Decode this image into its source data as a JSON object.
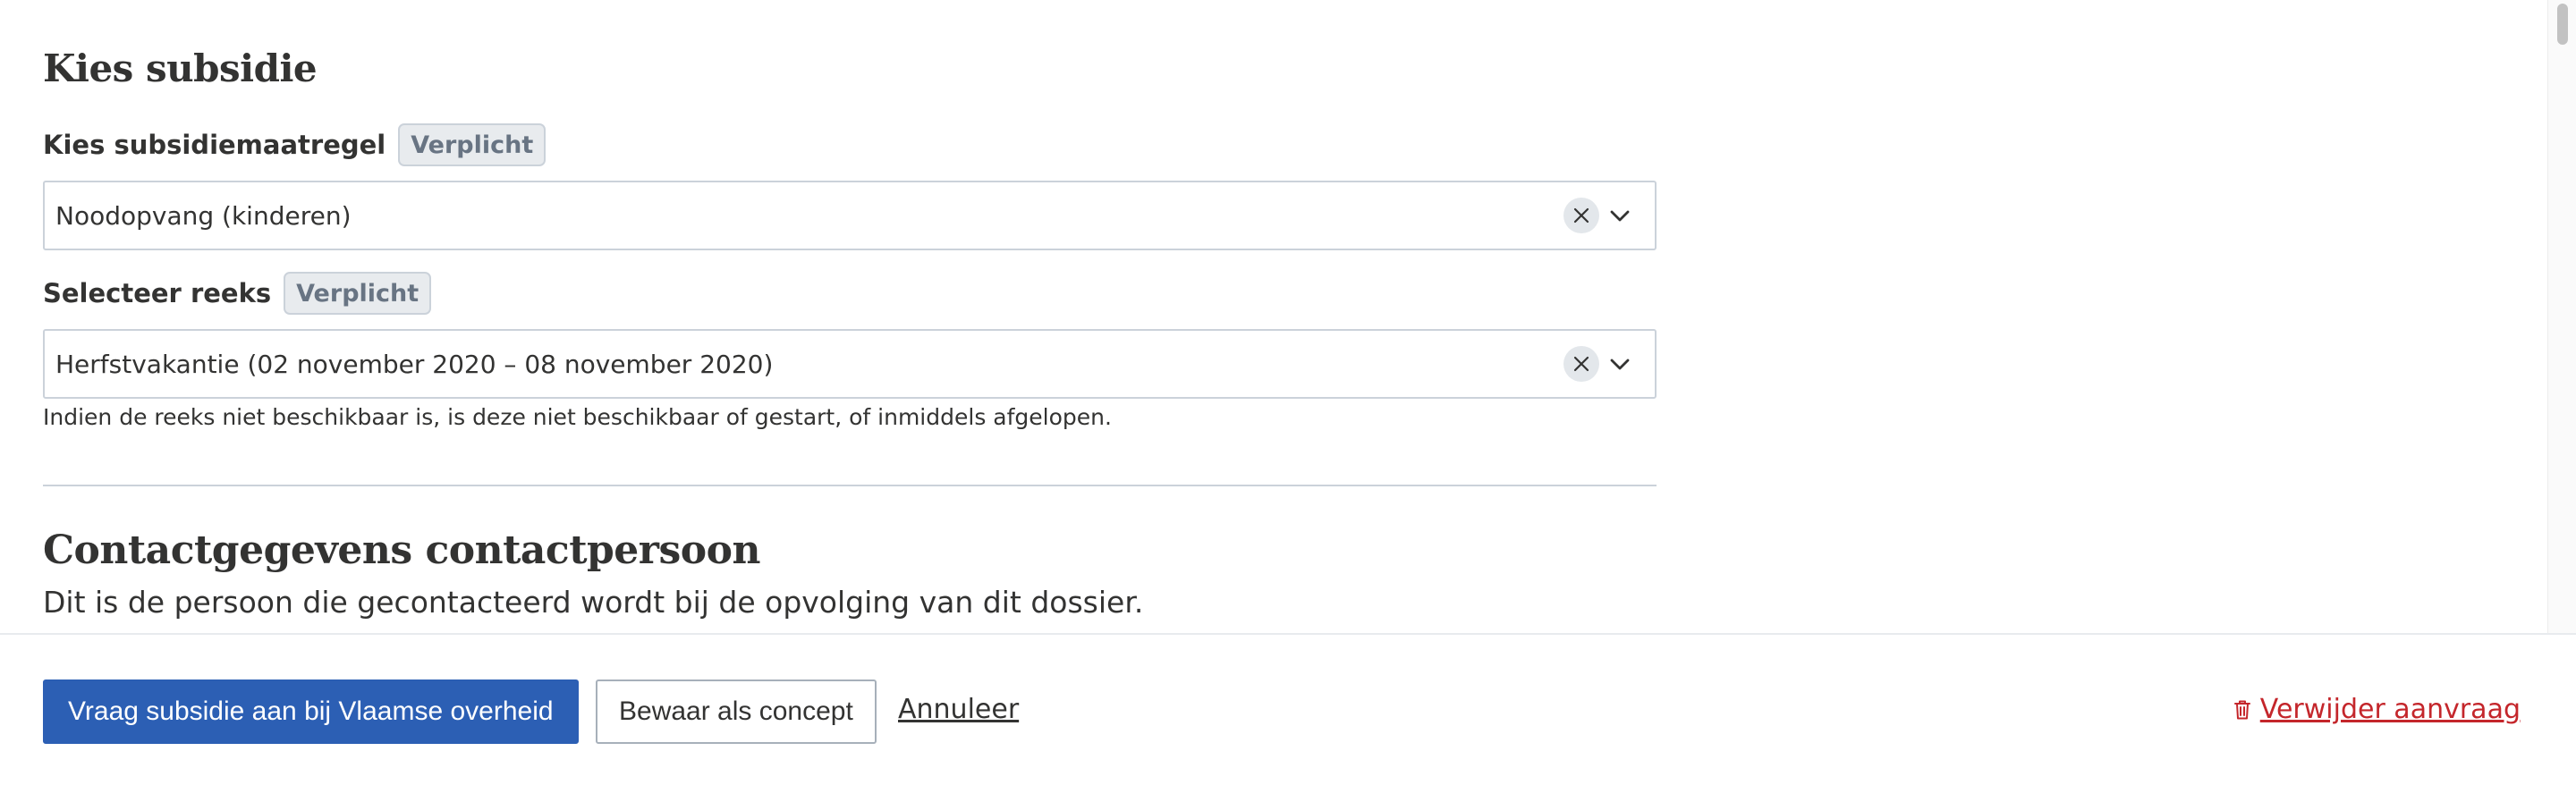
{
  "section_subsidie": {
    "title": "Kies subsidie",
    "maatregel": {
      "label": "Kies subsidiemaatregel",
      "badge": "Verplicht",
      "value": "Noodopvang (kinderen)"
    },
    "reeks": {
      "label": "Selecteer reeks",
      "badge": "Verplicht",
      "value": "Herfstvakantie (02 november 2020 – 08 november 2020)",
      "helper": "Indien de reeks niet beschikbaar is, is deze niet beschikbaar of gestart, of inmiddels afgelopen."
    }
  },
  "section_contact": {
    "title": "Contactgegevens contactpersoon",
    "subtitle": "Dit is de persoon die gecontacteerd wordt bij de opvolging van dit dossier."
  },
  "footer": {
    "submit_label": "Vraag subsidie aan bij Vlaamse overheid",
    "save_label": "Bewaar als concept",
    "cancel_label": "Annuleer",
    "delete_label": "Verwijder aanvraag"
  },
  "colors": {
    "primary": "#2c5fb4",
    "danger": "#c4262b",
    "text": "#333332",
    "badge_bg": "#e8ebee",
    "border": "#cbd2da"
  },
  "icons": {
    "clear": "close-icon",
    "dropdown": "chevron-down-icon",
    "delete": "trash-icon"
  }
}
